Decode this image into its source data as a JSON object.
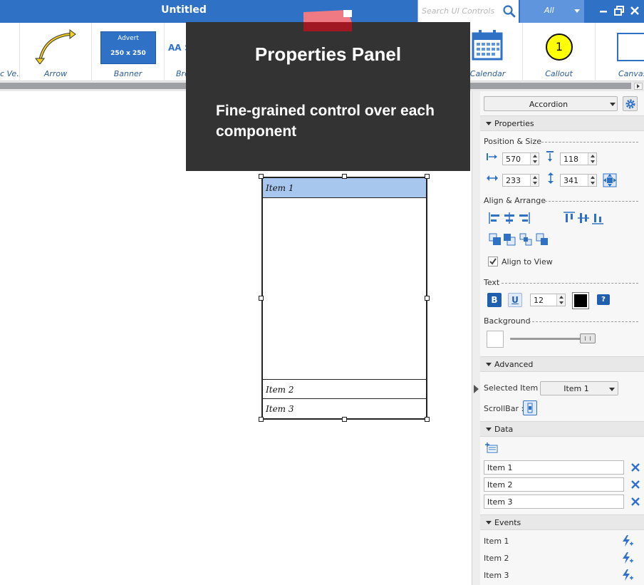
{
  "window": {
    "title": "Untitled",
    "search_placeholder": "Search UI Controls",
    "filter_value": "All",
    "accent": "#2f72c5"
  },
  "ribbon": {
    "items": [
      {
        "label": "c Ve...",
        "icon": "video-icon"
      },
      {
        "label": "Arrow",
        "icon": "curved-arrow-icon"
      },
      {
        "label": "Banner",
        "icon": "banner-icon",
        "banner_title": "Advert",
        "banner_size": "250 x 250"
      },
      {
        "label": "Bre",
        "icon": "breadcrumb-icon",
        "icon_text": "AA >"
      },
      {
        "label": "Calendar",
        "icon": "calendar-icon"
      },
      {
        "label": "Callout",
        "icon": "callout-icon",
        "callout_text": "1"
      },
      {
        "label": "Canvas",
        "icon": "canvas-icon"
      }
    ]
  },
  "tooltip": {
    "title": "Properties Panel",
    "body": "Fine-grained control over each component"
  },
  "canvas": {
    "accordion": {
      "items": [
        "Item 1",
        "Item 2",
        "Item 3"
      ],
      "selected": "Item 1"
    }
  },
  "panel": {
    "component": "Accordion",
    "properties_header": "Properties",
    "position_size_label": "Position & Size",
    "x": "570",
    "y": "118",
    "width": "233",
    "height": "341",
    "align_label": "Align & Arrange",
    "align_to_view": "Align to View",
    "align_to_view_checked": true,
    "text_label": "Text",
    "bold_label": "B",
    "underline_label": "U",
    "font_size": "12",
    "text_color": "#000000",
    "help_icon": "?",
    "background_label": "Background",
    "advanced_header": "Advanced",
    "selected_item_label": "Selected Item :",
    "selected_item_value": "Item 1",
    "scrollbar_label": "ScrollBar :",
    "data_header": "Data",
    "data_items": [
      "Item 1",
      "Item 2",
      "Item 3"
    ],
    "events_header": "Events",
    "event_items": [
      "Item 1",
      "Item 2",
      "Item 3"
    ]
  }
}
